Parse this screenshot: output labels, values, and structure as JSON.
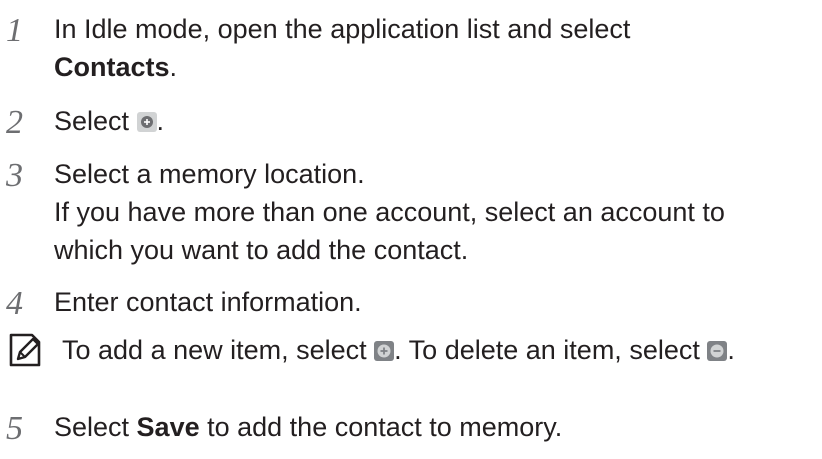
{
  "steps": [
    {
      "number": "1",
      "line1": "In Idle mode, open the application list and select",
      "line2_bold": "Contacts",
      "line2_end": "."
    },
    {
      "number": "2",
      "text_before": "Select ",
      "text_after": "."
    },
    {
      "number": "3",
      "line1": "Select a memory location.",
      "line2": "If you have more than one account, select an account to",
      "line3": "which you want to add the contact."
    },
    {
      "number": "4",
      "line1": "Enter contact information."
    },
    {
      "number": "5",
      "text_before": "Select ",
      "bold": "Save",
      "text_after": " to add the contact to memory."
    }
  ],
  "note": {
    "part1": "To add a new item, select ",
    "part2": ". To delete an item, select ",
    "part3": "."
  },
  "icons": {
    "note": "note-pencil-icon",
    "add_light": "add-icon",
    "add_dark": "add-item-icon",
    "delete_dark": "delete-item-icon"
  }
}
